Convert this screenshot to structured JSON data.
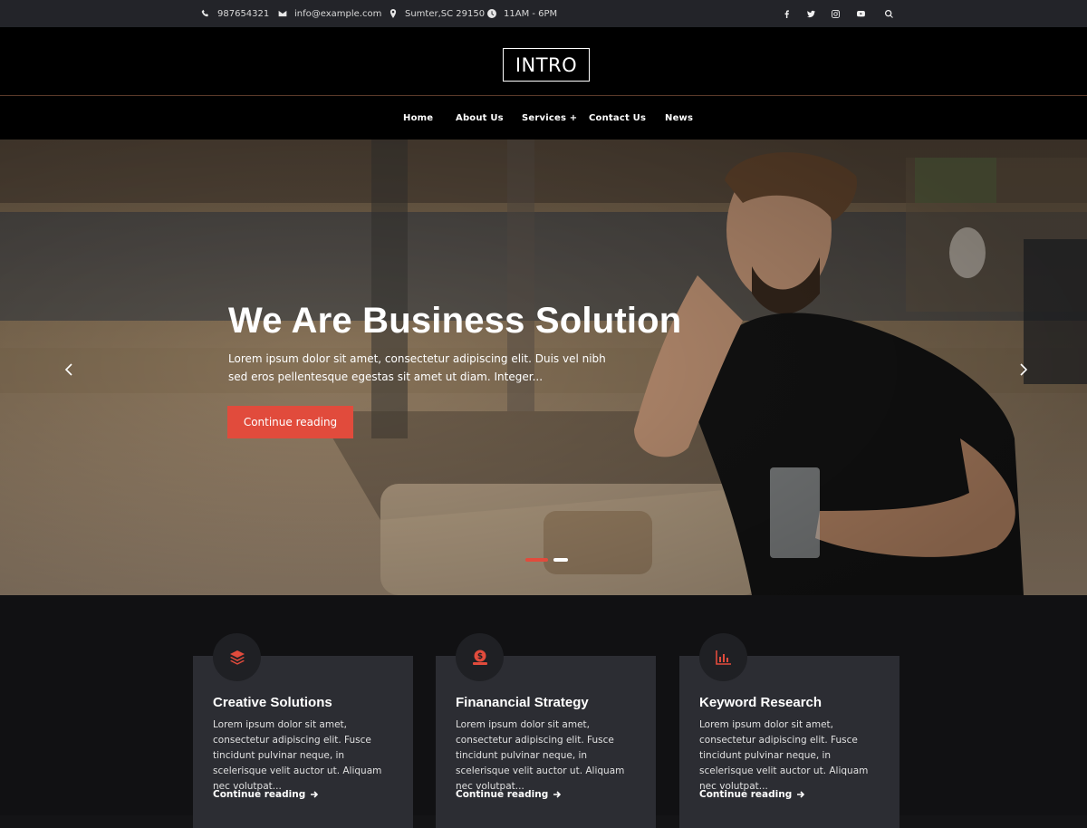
{
  "topbar": {
    "phone": "987654321",
    "email": "info@example.com",
    "address": "Sumter,SC 29150",
    "hours": "11AM - 6PM",
    "social_icons": [
      "facebook-icon",
      "twitter-icon",
      "instagram-icon",
      "youtube-icon",
      "search-icon"
    ]
  },
  "header": {
    "logo": "INTRO",
    "nav": [
      {
        "label": "Home"
      },
      {
        "label": "About Us"
      },
      {
        "label": "Services +"
      },
      {
        "label": "Contact Us"
      },
      {
        "label": "News"
      }
    ]
  },
  "hero": {
    "title": "We Are Business Solution",
    "text": "Lorem ipsum dolor sit amet, consectetur adipiscing elit. Duis vel nibh sed eros pellentesque egestas sit amet ut diam. Integer...",
    "button": "Continue reading",
    "slides_count": 2,
    "active_slide": 1
  },
  "features": [
    {
      "icon": "layers-icon",
      "title": "Creative Solutions",
      "text": "Lorem ipsum dolor sit amet, consectetur adipiscing elit. Fusce tincidunt pulvinar neque, in scelerisque velit auctor ut. Aliquam nec volutpat...",
      "link": "Continue reading"
    },
    {
      "icon": "money-hand-icon",
      "title": "Finanancial Strategy",
      "text": "Lorem ipsum dolor sit amet, consectetur adipiscing elit. Fusce tincidunt pulvinar neque, in scelerisque velit auctor ut. Aliquam nec volutpat...",
      "link": "Continue reading"
    },
    {
      "icon": "bar-chart-icon",
      "title": "Keyword Research",
      "text": "Lorem ipsum dolor sit amet, consectetur adipiscing elit. Fusce tincidunt pulvinar neque, in scelerisque velit auctor ut. Aliquam nec volutpat...",
      "link": "Continue reading"
    }
  ],
  "colors": {
    "accent": "#e14b3c",
    "topbar_bg": "#232429",
    "header_bg": "#000000",
    "card_bg": "#2c2d33",
    "section_bg": "#111113"
  }
}
